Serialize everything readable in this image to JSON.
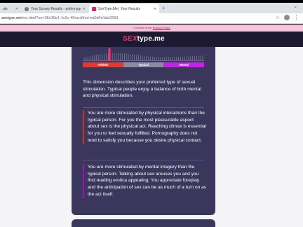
{
  "browser": {
    "tabs": [
      {
        "label": "uts",
        "active": false
      },
      {
        "label": "Your Survey Results - anthonyge",
        "active": false
      },
      {
        "label": "SexType.Me | Your Results",
        "active": true
      }
    ],
    "new_tab": "+",
    "url_domain": "sextype.me",
    "url_path": "/me.html?uu=36e36e1-1c0c-40ea-b5ed-ea0d4e1de3353"
  },
  "consent": {
    "text": "I consent to the",
    "link": "Privacy Policy"
  },
  "header": {
    "logo_highlight": "SEX",
    "logo_rest": "type.me"
  },
  "scale": {
    "labels": {
      "athletic": "Athletic",
      "typical": "Typical",
      "mental": "Mental"
    },
    "colors": {
      "athletic": "#e23b2e",
      "typical": "#8c8aa3",
      "mental": "#c422e6"
    },
    "marker_position_pct": 22
  },
  "description": "This dimension describes your preferred type of sexual stimulation. Typical people enjoy a balance of both mental and physical stimulation.",
  "results": [
    {
      "text": "You are more stimulated by physical interactions than the typical person. For you the most pleasurable aspect about sex is the physical act. Reaching climax is essential for you to feel sexually fulfilled. Pornography does not tend to satisfy you because you desire physical contact."
    },
    {
      "text": "You are more stimulated by mental imagery than the typical person. Talking about sex arouses you and you find reading erotica appealing. You appreciate foreplay and the anticipation of sex can be as much of a turn on as the act itself."
    }
  ]
}
